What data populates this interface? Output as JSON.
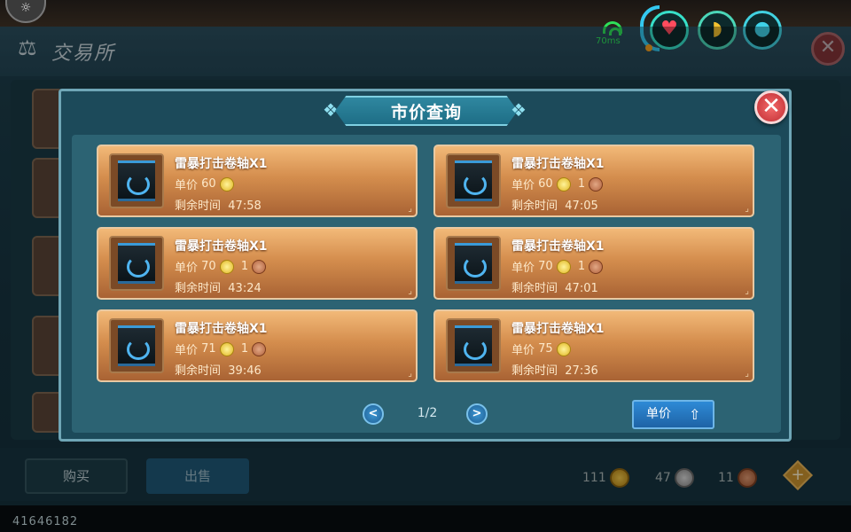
{
  "background": {
    "title": "交易所",
    "buy_label": "购买",
    "sell_label": "出售",
    "currency": {
      "gold": "111",
      "silver": "47",
      "copper": "11"
    },
    "uid": "41646182"
  },
  "status": {
    "ping": "70ms"
  },
  "modal": {
    "title": "市价查询",
    "listings": [
      {
        "name": "雷暴打击卷轴X1",
        "price_label": "单价",
        "gold": "60",
        "copper": "",
        "time_label": "剩余时间",
        "time": "47:58"
      },
      {
        "name": "雷暴打击卷轴X1",
        "price_label": "单价",
        "gold": "60",
        "copper": "1",
        "time_label": "剩余时间",
        "time": "47:05"
      },
      {
        "name": "雷暴打击卷轴X1",
        "price_label": "单价",
        "gold": "70",
        "copper": "1",
        "time_label": "剩余时间",
        "time": "43:24"
      },
      {
        "name": "雷暴打击卷轴X1",
        "price_label": "单价",
        "gold": "70",
        "copper": "1",
        "time_label": "剩余时间",
        "time": "47:01"
      },
      {
        "name": "雷暴打击卷轴X1",
        "price_label": "单价",
        "gold": "71",
        "copper": "1",
        "time_label": "剩余时间",
        "time": "39:46"
      },
      {
        "name": "雷暴打击卷轴X1",
        "price_label": "单价",
        "gold": "75",
        "copper": "",
        "time_label": "剩余时间",
        "time": "27:36"
      }
    ],
    "pagination": "1/2",
    "sort_label": "单价"
  },
  "icons": {
    "prev": "chevron-left-icon",
    "next": "chevron-right-icon",
    "close": "close-icon",
    "sort": "sort-up-icon"
  },
  "colors": {
    "card_top": "#f2b978",
    "card_bottom": "#a96334",
    "modal_bg": "#1c4a5a",
    "accent_blue": "#2e8ad6",
    "close_red": "#c12d33"
  }
}
